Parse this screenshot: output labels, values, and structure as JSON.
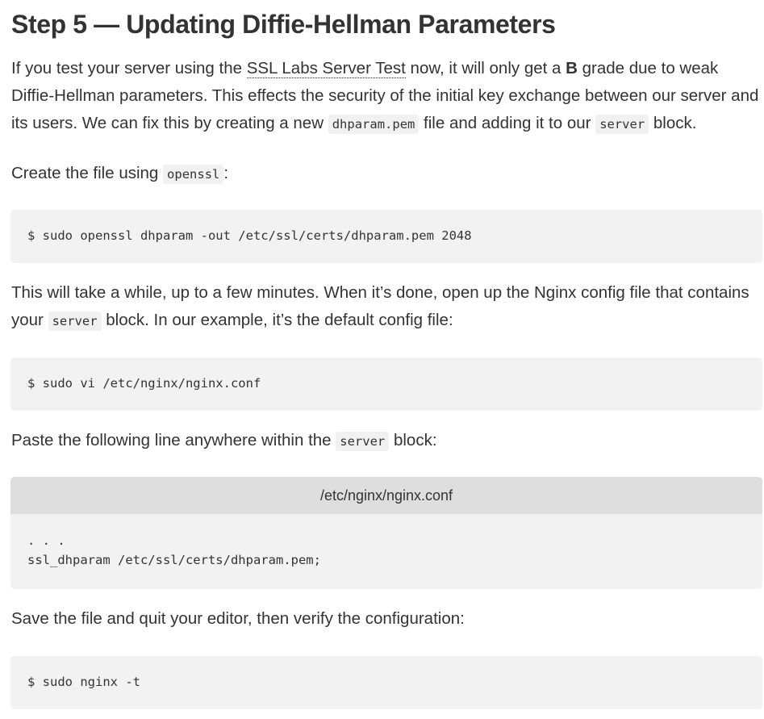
{
  "heading": "Step 5 — Updating Diffie-Hellman Parameters",
  "para1": {
    "t1": "If you test your server using the ",
    "link": "SSL Labs Server Test",
    "t2": " now, it will only get a ",
    "grade": "B",
    "t3": " grade due to weak Diffie-Hellman parameters. This effects the security of the initial key exchange between our server and its users. We can fix this by creating a new ",
    "code1": "dhparam.pem",
    "t4": " file and adding it to our ",
    "code2": "server",
    "t5": " block."
  },
  "para2": {
    "t1": "Create the file using ",
    "code1": "openssl",
    "t2": ":"
  },
  "code_block1": {
    "line": "$ sudo openssl dhparam -out /etc/ssl/certs/dhparam.pem 2048"
  },
  "para3": {
    "t1": "This will take a while, up to a few minutes. When it’s done, open up the Nginx config file that contains your ",
    "code1": "server",
    "t2": " block. In our example, it’s the default config file:"
  },
  "code_block2": {
    "line": "$ sudo vi /etc/nginx/nginx.conf"
  },
  "para4": {
    "t1": "Paste the following line anywhere within the ",
    "code1": "server",
    "t2": " block:"
  },
  "code_block3": {
    "label": "/etc/nginx/nginx.conf",
    "line1": ". . .",
    "line2": "ssl_dhparam /etc/ssl/certs/dhparam.pem;"
  },
  "para5": {
    "t1": "Save the file and quit your editor, then verify the configuration:"
  },
  "code_block4": {
    "line": "$ sudo nginx -t"
  }
}
